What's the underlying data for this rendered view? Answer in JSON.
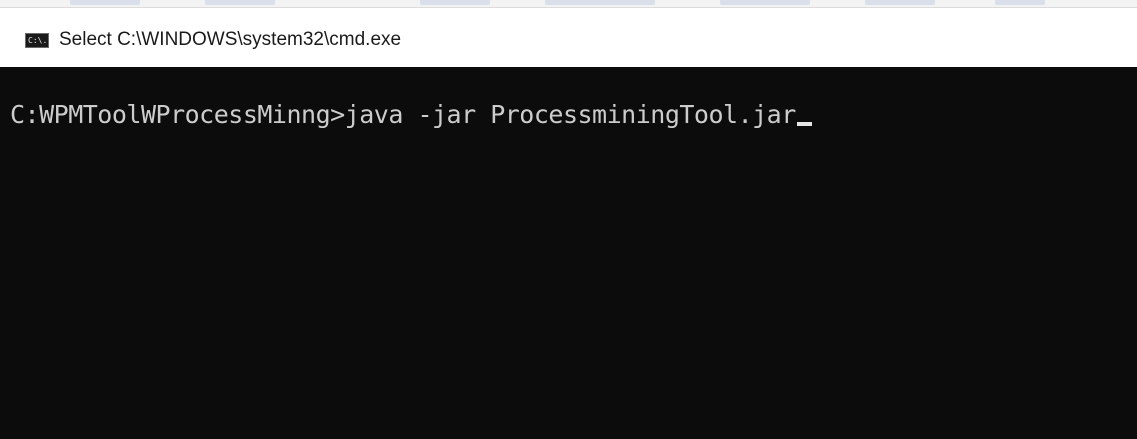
{
  "window": {
    "title": "Select C:\\WINDOWS\\system32\\cmd.exe",
    "icon": "cmd-console-icon",
    "icon_label": "C:\\."
  },
  "console": {
    "prompt": "C:WPMToolWProcessMinng>",
    "command": "java -jar ProcessminingTool.jar"
  },
  "colors": {
    "console_background": "#0c0c0c",
    "console_text": "#cccccc",
    "titlebar_background": "#ffffff"
  }
}
